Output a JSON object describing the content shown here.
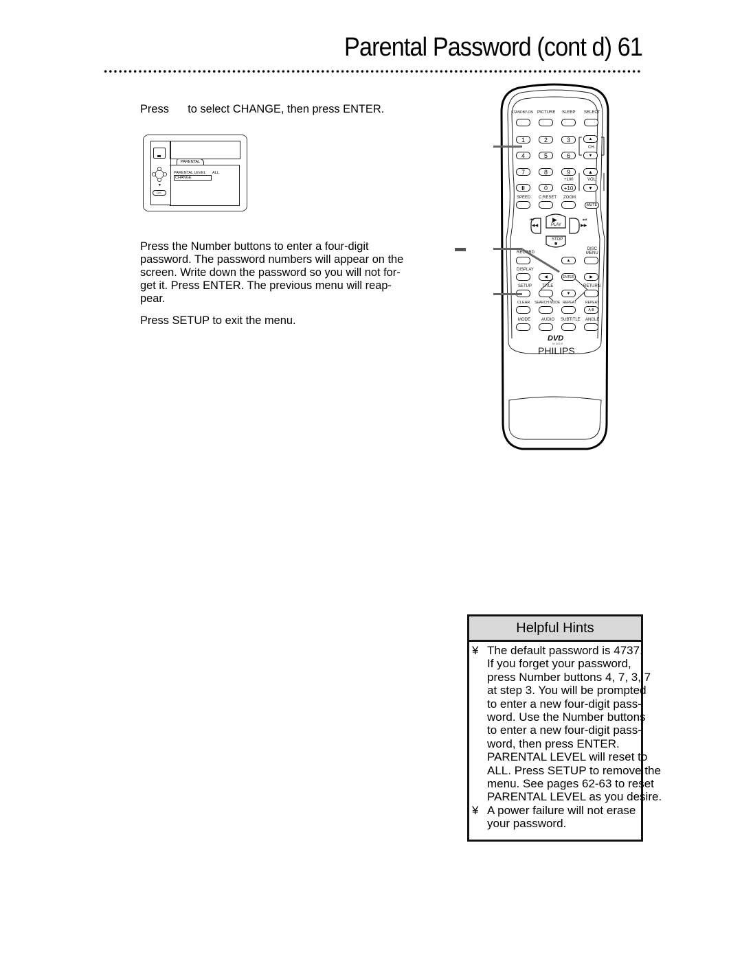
{
  "page": {
    "title": "Parental Password (cont d)  61"
  },
  "steps": {
    "step2": "Press      to select CHANGE, then press ENTER.",
    "step3_lines": [
      "Press the Number buttons to enter a four-digit",
      "password.  The password numbers will appear on the",
      "screen.  Write down the password so you will not for-",
      "get it.  Press ENTER.  The previous menu will reap-",
      "pear."
    ],
    "step4": "Press SETUP to exit the menu."
  },
  "osd": {
    "tab_label": "PARENTAL",
    "parental_level_label": "PARENTAL LEVEL",
    "parental_level_value": "ALL",
    "change_label": "CHANGE",
    "ok_label": "O.K."
  },
  "remote": {
    "brand": "PHILIPS",
    "logo": "DVD",
    "logo_sub": "VIDEO",
    "top_row": [
      "STANDBY-ON",
      "PICTURE",
      "SLEEP",
      "SELECT"
    ],
    "numbers": [
      "1",
      "2",
      "3",
      "4",
      "5",
      "6",
      "7",
      "8",
      "9"
    ],
    "pause_label": "II",
    "zero_label": "0",
    "plus10_label": "+10",
    "plus100_label": "+100",
    "ch_label": "CH.",
    "vol_label": "VOL.",
    "row_speed": [
      "SPEED",
      "C.RESET",
      "ZOOM"
    ],
    "mute_label": "MUTE",
    "play_label": "PLAY",
    "stop_label": "STOP",
    "record_label": "RECORD",
    "disc_menu_label": "DISC\nMENU",
    "display_label": "DISPLAY",
    "enter_label": "ENTER",
    "row_setup": [
      "SETUP",
      "TITLE",
      "RETURN"
    ],
    "row_clear": [
      "CLEAR",
      "SEARCH MODE",
      "REPEAT",
      "REPEAT"
    ],
    "ab_label": "A-B",
    "row_mode": [
      "MODE",
      "AUDIO",
      "SUBTITLE",
      "ANGLE"
    ]
  },
  "hints": {
    "header": "Helpful Hints",
    "bullet": "¥",
    "items": [
      [
        "The default password is 4737.",
        "If you forget your password,",
        "press Number buttons 4, 7, 3, 7",
        "at step 3.  You will be prompted",
        "to enter a new four-digit pass-",
        "word.  Use the Number buttons",
        "to enter a new four-digit pass-",
        "word, then press ENTER.",
        "PARENTAL LEVEL will reset to",
        "ALL. Press SETUP to remove the",
        "menu.  See pages 62-63 to reset",
        "PARENTAL LEVEL as you desire."
      ],
      [
        "A power failure will not erase",
        "your password."
      ]
    ]
  }
}
